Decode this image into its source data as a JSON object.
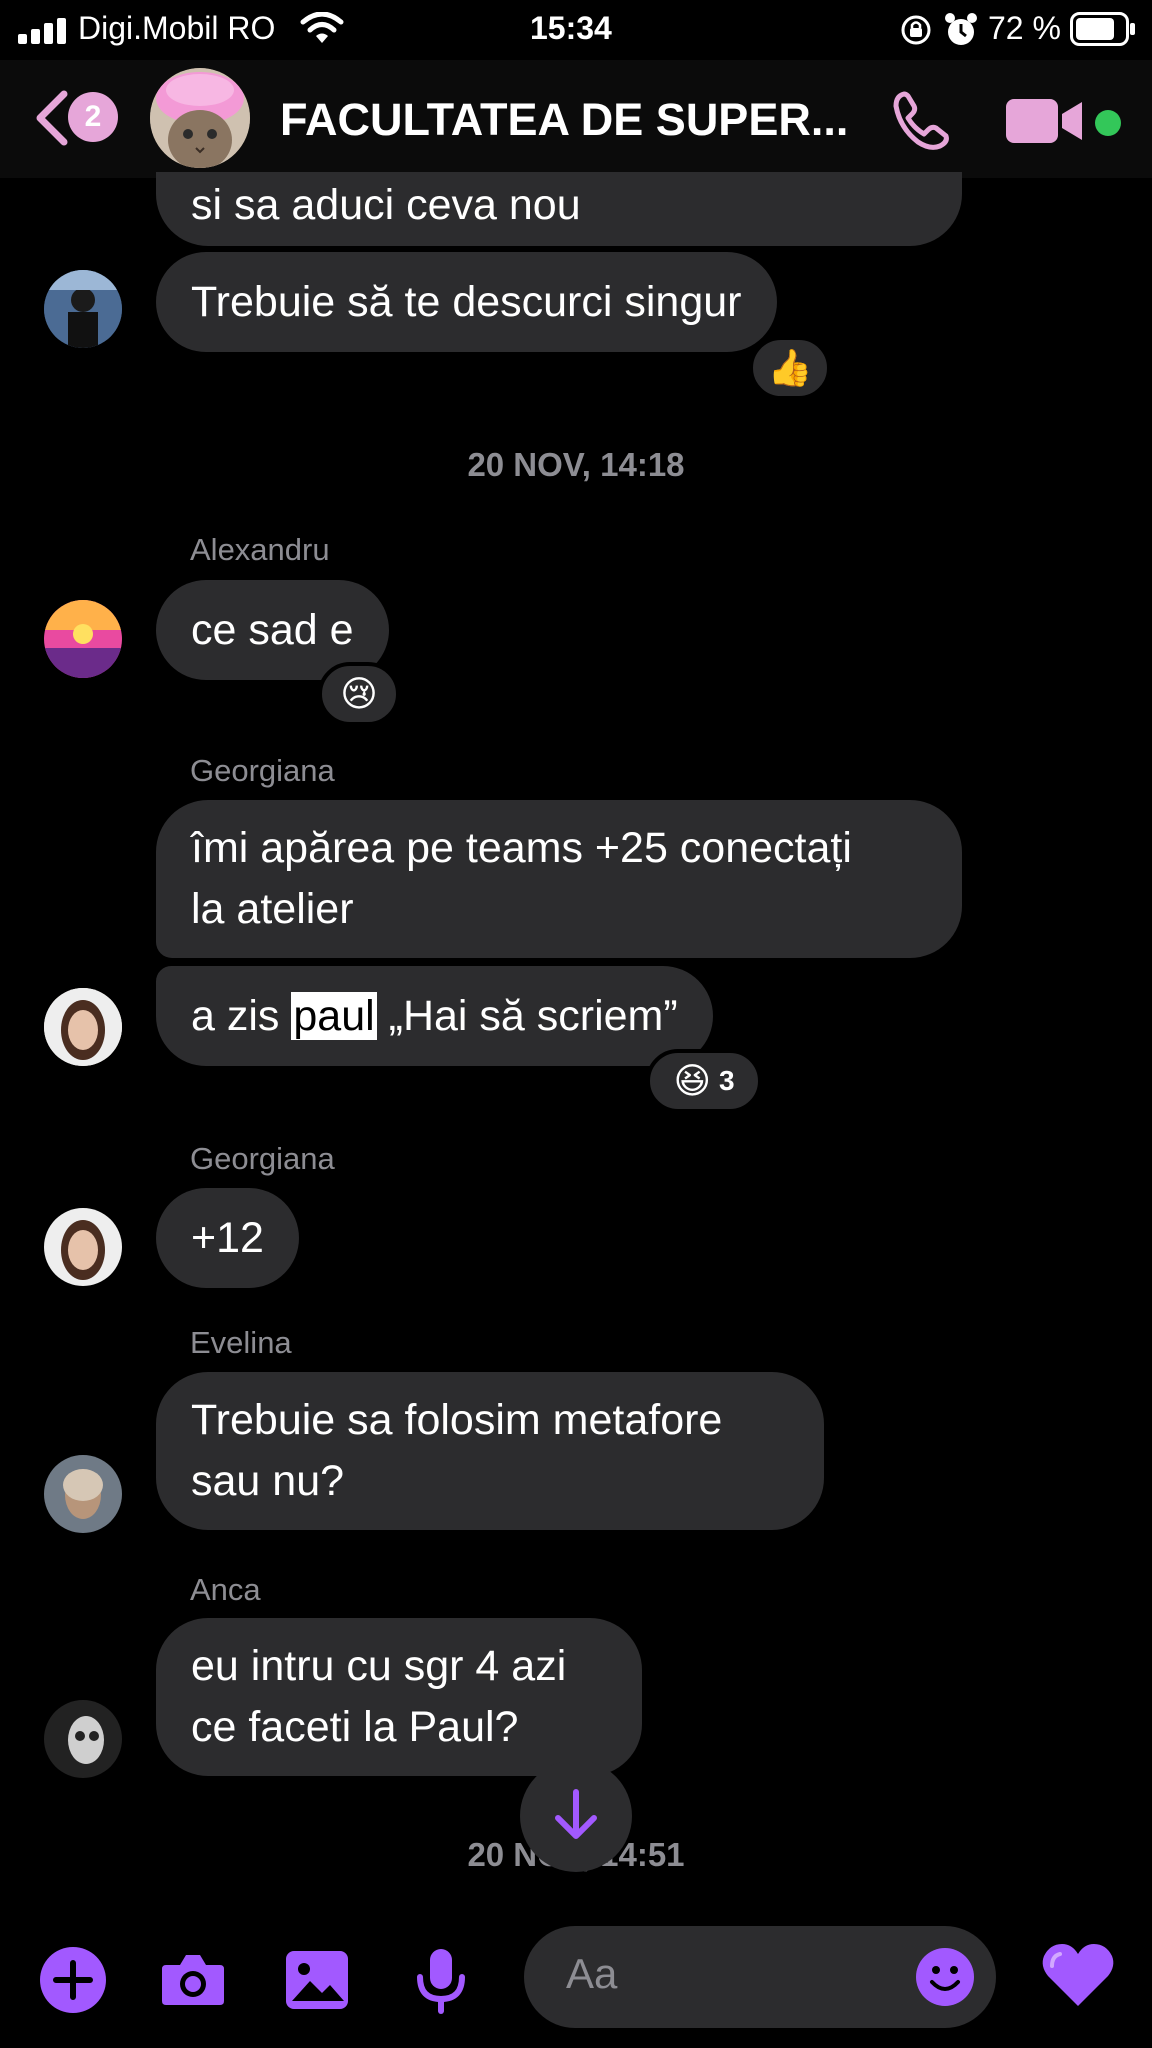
{
  "status_bar": {
    "carrier": "Digi.Mobil RO",
    "time": "15:34",
    "battery_pct": "72 %"
  },
  "header": {
    "back_badge": "2",
    "title": "FACULTATEA DE SUPER...",
    "accent_color": "#e6a6d9",
    "online_color": "#33c759"
  },
  "messages": [
    {
      "text_lines": [
        "si sa aduci ceva nou"
      ]
    },
    {
      "text_lines": [
        "Trebuie să te descurci singur"
      ],
      "reaction": "👍"
    },
    {
      "date": "20 NOV, 14:18"
    },
    {
      "sender": "Alexandru",
      "text_lines": [
        "ce sad e"
      ],
      "reaction": "😢"
    },
    {
      "sender": "Georgiana",
      "text_lines": [
        "îmi apărea pe teams +25 conectați",
        "la atelier"
      ]
    },
    {
      "text_before": "a zis ",
      "highlight": "paul",
      "text_after": " „Hai să scriem”",
      "reaction": "😆",
      "reaction_count": "3"
    },
    {
      "sender": "Georgiana",
      "text_lines": [
        "+12"
      ]
    },
    {
      "sender": "Evelina",
      "text_lines": [
        "Trebuie sa folosim metafore",
        "sau nu?"
      ]
    },
    {
      "sender": "Anca",
      "text_lines": [
        "eu intru cu sgr 4 azi",
        "ce faceti la Paul?"
      ]
    },
    {
      "date": "20 NOV, 14:51"
    }
  ],
  "composer": {
    "placeholder": "Aa",
    "accent_color": "#a259ff"
  }
}
